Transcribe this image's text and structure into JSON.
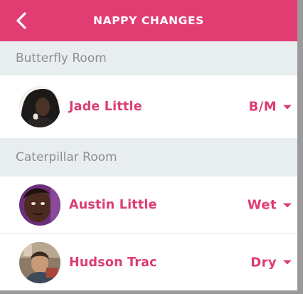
{
  "header": {
    "title": "NAPPY CHANGES",
    "back_icon": "chevron-left-icon",
    "background": "#e23d72"
  },
  "accent_color": "#dc3c74",
  "sections": [
    {
      "title": "Butterfly Room",
      "children": [
        {
          "name": "Jade Little",
          "status": "B/M"
        }
      ]
    },
    {
      "title": "Caterpillar Room",
      "children": [
        {
          "name": "Austin Little",
          "status": "Wet"
        },
        {
          "name": "Hudson Trac",
          "status": "Dry"
        }
      ]
    }
  ]
}
